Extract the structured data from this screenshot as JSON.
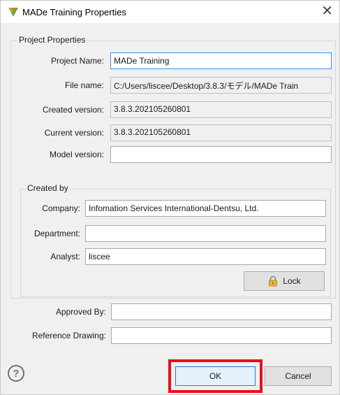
{
  "window": {
    "title": "MADe Training Properties",
    "close_glyph": "✕"
  },
  "project_properties": {
    "group_label": "Project Properties",
    "project_name_label": "Project Name:",
    "project_name_value": "MADe Training",
    "file_name_label": "File name:",
    "file_name_value": "C:/Users/liscee/Desktop/3.8.3/モデル/MADe Train",
    "created_version_label": "Created version:",
    "created_version_value": "3.8.3.202105260801",
    "current_version_label": "Current version:",
    "current_version_value": "3.8.3.202105260801",
    "model_version_label": "Model version:",
    "model_version_value": ""
  },
  "created_by": {
    "group_label": "Created by",
    "company_label": "Company:",
    "company_value": "Infomation Services International-Dentsu, Ltd.",
    "department_label": "Department:",
    "department_value": "",
    "analyst_label": "Analyst:",
    "analyst_value": "liscee",
    "lock_label": "Lock"
  },
  "approval": {
    "approved_by_label": "Approved By:",
    "approved_by_value": "",
    "reference_drawing_label": "Reference Drawing:",
    "reference_drawing_value": ""
  },
  "buttons": {
    "help_glyph": "?",
    "ok_label": "OK",
    "cancel_label": "Cancel"
  },
  "colors": {
    "highlight": "#e8101b",
    "focus_border": "#3c8ff0"
  }
}
